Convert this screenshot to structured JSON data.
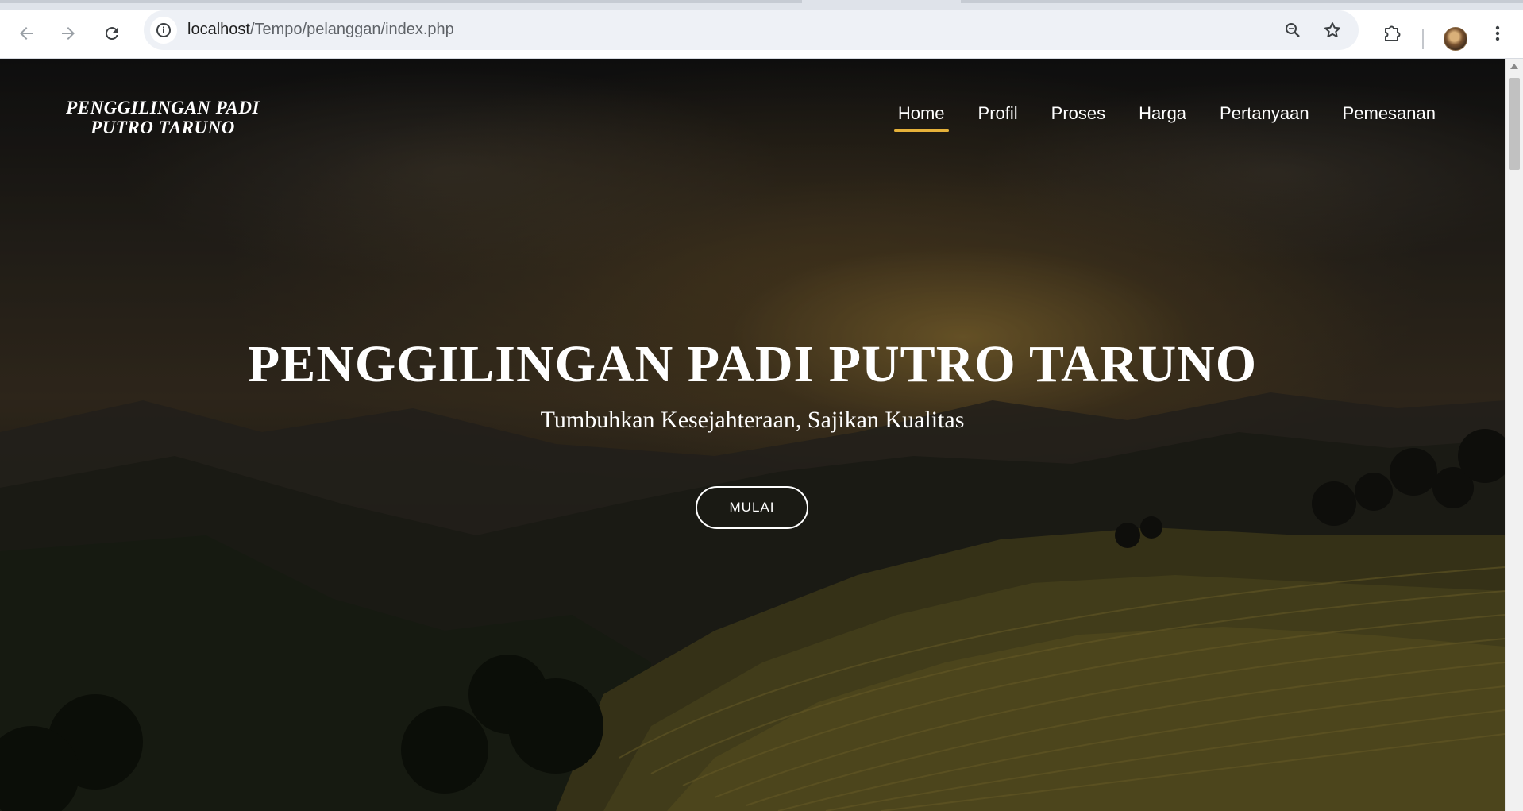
{
  "browser": {
    "url_host": "localhost",
    "url_path": "/Tempo/pelanggan/index.php",
    "icons": {
      "back": "arrow-left-icon",
      "forward": "arrow-right-icon",
      "reload": "reload-icon",
      "site_info": "info-icon",
      "zoom": "zoom-icon",
      "bookmark": "star-icon",
      "extensions": "puzzle-icon",
      "menu": "kebab-menu-icon"
    }
  },
  "site": {
    "brand_line1": "PENGGILINGAN PADI",
    "brand_line2": "PUTRO TARUNO",
    "nav": [
      {
        "label": "Home",
        "active": true
      },
      {
        "label": "Profil",
        "active": false
      },
      {
        "label": "Proses",
        "active": false
      },
      {
        "label": "Harga",
        "active": false
      },
      {
        "label": "Pertanyaan",
        "active": false
      },
      {
        "label": "Pemesanan",
        "active": false
      }
    ],
    "accent_color": "#e5b13a"
  },
  "hero": {
    "title": "PENGGILINGAN PADI PUTRO TARUNO",
    "subtitle": "Tumbuhkan Kesejahteraan, Sajikan Kualitas",
    "button_label": "MULAI",
    "background": "rice terraces at sunset"
  }
}
